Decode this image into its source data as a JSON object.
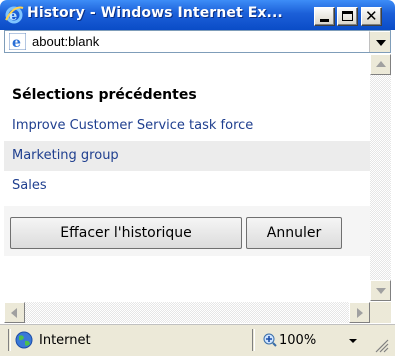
{
  "window": {
    "title": "History - Windows Internet Ex...",
    "titlebar_color": "#1b5fd8"
  },
  "address": {
    "url": "about:blank",
    "icon": "ie-page-icon"
  },
  "content": {
    "heading": "Sélections précédentes",
    "items": [
      {
        "label": "Improve Customer Service task force"
      },
      {
        "label": "Marketing group"
      },
      {
        "label": "Sales"
      }
    ],
    "link_color": "#1f3f8f",
    "buttons": {
      "clear_label": "Effacer l'historique",
      "cancel_label": "Annuler"
    }
  },
  "statusbar": {
    "zone_label": "Internet",
    "zoom_label": "100%"
  }
}
